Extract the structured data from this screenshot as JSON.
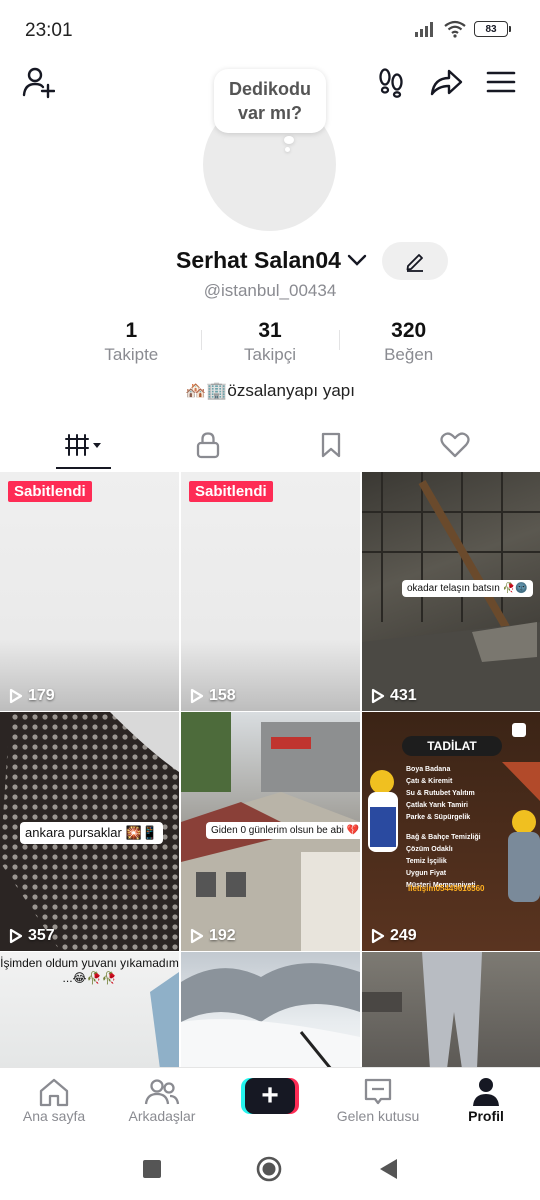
{
  "status": {
    "time": "23:01",
    "battery": "83"
  },
  "profile": {
    "bubble_text": "Dedikodu var mı?",
    "display_name": "Serhat Salan04",
    "username": "@istanbul_00434",
    "bio": "🏘️🏢özsalanyapı yapı"
  },
  "stats": [
    {
      "value": "1",
      "label": "Takipte"
    },
    {
      "value": "31",
      "label": "Takipçi"
    },
    {
      "value": "320",
      "label": "Beğen"
    }
  ],
  "videos": [
    {
      "pinned": "Sabitlendi",
      "views": "179"
    },
    {
      "pinned": "Sabitlendi",
      "views": "158"
    },
    {
      "caption": "okadar telaşın batsın 🥀🌚",
      "views": "431"
    },
    {
      "caption": "ankara pursaklar 🎇📱",
      "views": "357"
    },
    {
      "caption": "Giden 0 günlerim olsun be abi 💔",
      "views": "192"
    },
    {
      "ad_title": "TADİLAT",
      "ad_items": [
        "Boya Badana",
        "Çatı & Kiremit",
        "Su & Rutubet Yalıtım",
        "Çatlak Yarık Tamiri",
        "Parke & Süpürgelik",
        "Bağ & Bahçe Temizliği",
        "Çözüm Odaklı",
        "Temiz İşçilik",
        "Uygun Fiyat",
        "Müşteri Memnuniyeti"
      ],
      "ad_phone": "iletişim05449616560",
      "views": "249"
    },
    {
      "caption": "İşimden oldum yuvanı yıkamadım ...😂🥀🥀"
    },
    {},
    {}
  ],
  "nav": {
    "home": "Ana sayfa",
    "friends": "Arkadaşlar",
    "create": "+",
    "inbox": "Gelen kutusu",
    "profile": "Profil"
  }
}
